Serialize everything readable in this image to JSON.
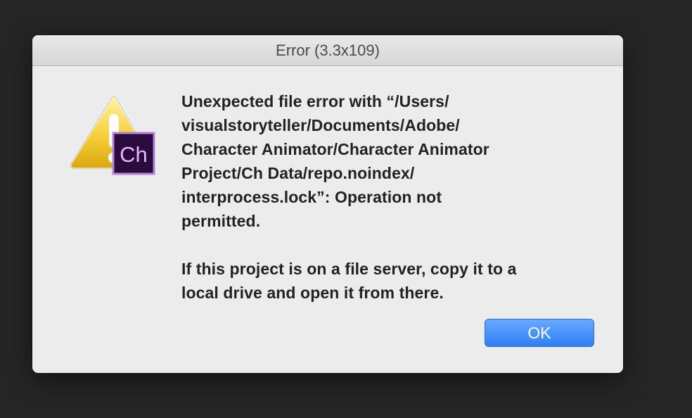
{
  "dialog": {
    "title": "Error (3.3x109)",
    "message_paragraphs": [
      "Unexpected file error with “/Users/\nvisualstoryteller/Documents/Adobe/\nCharacter Animator/Character Animator\nProject/Ch Data/repo.noindex/\ninterprocess.lock”: Operation not\npermitted.",
      "If this project is on a file server, copy it to a\nlocal drive and open it from there."
    ],
    "ok_label": "OK",
    "app_badge": "Ch",
    "icons": {
      "warning": "warning-icon",
      "app": "character-animator-app-icon"
    },
    "colors": {
      "accent": "#3b86f7",
      "badge_background": "#2b0a3d",
      "badge_text": "#e5b8ff",
      "warning_yellow": "#f5c518"
    }
  }
}
